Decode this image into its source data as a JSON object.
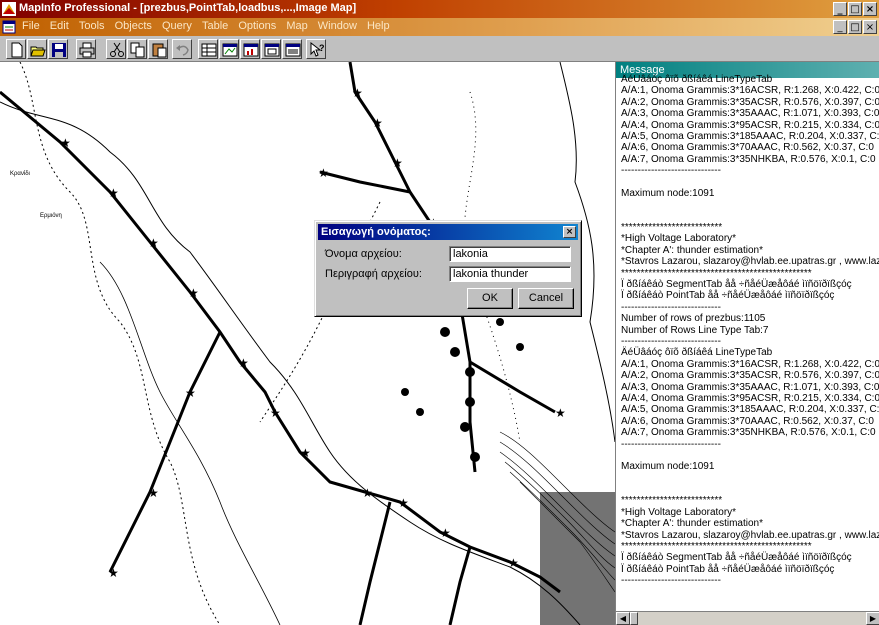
{
  "window": {
    "title": "MapInfo Professional - [prezbus,PointTab,loadbus,...,Image Map]",
    "controls": [
      "_",
      "В",
      "×"
    ]
  },
  "menu": {
    "items": [
      "File",
      "Edit",
      "Tools",
      "Objects",
      "Query",
      "Table",
      "Options",
      "Map",
      "Window",
      "Help"
    ]
  },
  "toolbar": {
    "icons": [
      "new-icon",
      "open-icon",
      "save-icon",
      "print-icon",
      "cut-icon",
      "copy-icon",
      "paste-icon",
      "undo-icon",
      "new-browser-icon",
      "new-mapper-icon",
      "new-grapher-icon",
      "new-layout-icon",
      "redistrict-icon",
      "help-pointer-icon"
    ]
  },
  "colors": {
    "title_bar": "#800000",
    "menu_bar": "#c06000",
    "message_title": "#008080",
    "dialog_title": "#000080"
  },
  "message_panel": {
    "title": "Message",
    "lines": [
      "ÄéÜâáóç ôïõ ðßíáêá LineTypeTab",
      "A/A:1, Onoma Grammis:3*16ACSR, R:1.268, X:0.422, C:0",
      "A/A:2, Onoma Grammis:3*35ACSR, R:0.576, X:0.397, C:0",
      "A/A:3, Onoma Grammis:3*35AAAC, R:1.071, X:0.393, C:0",
      "A/A:4, Onoma Grammis:3*95ACSR, R:0.215, X:0.334, C:0",
      "A/A:5, Onoma Grammis:3*185AAAC, R:0.204, X:0.337, C:0",
      "A/A:6, Onoma Grammis:3*70AAAC, R:0.562, X:0.37, C:0",
      "A/A:7, Onoma Grammis:3*35NHKBA, R:0.576, X:0.1, C:0",
      "------------------------------",
      "",
      "Maximum node:1091",
      "",
      "",
      "**************************",
      "*High Voltage Laboratory*",
      "*Chapter A': thunder estimation*",
      "*Stavros Lazarou, slazaroy@hvlab.ee.upatras.gr , www.laza",
      "*************************************************",
      "Ï ðßíáêáò SegmentTab åå ÷ñåéÜæåôáé ìïñöïðïßçóç",
      "Ï ðßíáêáò PointTab åå ÷ñåéÜæåôáé ìïñöïðïßçóç",
      "------------------------------",
      "Number of rows of prezbus:1105",
      "Number of Rows Line Type Tab:7",
      "------------------------------",
      "ÄéÜâáóç ôïõ ðßíáêá LineTypeTab",
      "A/A:1, Onoma Grammis:3*16ACSR, R:1.268, X:0.422, C:0",
      "A/A:2, Onoma Grammis:3*35ACSR, R:0.576, X:0.397, C:0",
      "A/A:3, Onoma Grammis:3*35AAAC, R:1.071, X:0.393, C:0",
      "A/A:4, Onoma Grammis:3*95ACSR, R:0.215, X:0.334, C:0",
      "A/A:5, Onoma Grammis:3*185AAAC, R:0.204, X:0.337, C:0",
      "A/A:6, Onoma Grammis:3*70AAAC, R:0.562, X:0.37, C:0",
      "A/A:7, Onoma Grammis:3*35NHKBA, R:0.576, X:0.1, C:0",
      "------------------------------",
      "",
      "Maximum node:1091",
      "",
      "",
      "**************************",
      "*High Voltage Laboratory*",
      "*Chapter A': thunder estimation*",
      "*Stavros Lazarou, slazaroy@hvlab.ee.upatras.gr , www.laza",
      "*************************************************",
      "Ï ðßíáêáò SegmentTab åå ÷ñåéÜæåôáé ìïñöïðïßçóç",
      "Ï ðßíáêáò PointTab åå ÷ñåéÜæåôáé ìïñöïðïßçóç",
      "------------------------------"
    ]
  },
  "dialog": {
    "title": "Εισαγωγή ονόματος:",
    "close": "×",
    "filename_label": "Όνομα αρχείου:",
    "filename_value": "lakonia",
    "description_label": "Περιγραφή αρχείου:",
    "description_value": "lakonia thunder",
    "ok_label": "OK",
    "cancel_label": "Cancel"
  },
  "map": {
    "labels": [
      "Κρανίδι",
      "Ερμιόνη"
    ]
  }
}
